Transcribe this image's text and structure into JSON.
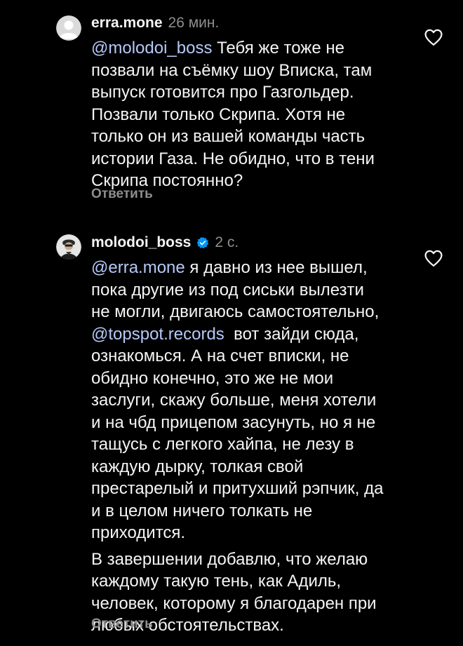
{
  "comments": [
    {
      "username": "erra.mone",
      "time": "26 мин.",
      "verified": false,
      "reply_label": "Ответить",
      "lines": [
        [
          {
            "m": "@molodoi_boss"
          },
          {
            "t": " Тебя же тоже не"
          }
        ],
        [
          {
            "t": "позвали на съёмку шоу Вписка, там"
          }
        ],
        [
          {
            "t": "выпуск готовится про Газгольдер."
          }
        ],
        [
          {
            "t": "Позвали только Скрипа. Хотя не"
          }
        ],
        [
          {
            "t": "только он из вашей команды часть"
          }
        ],
        [
          {
            "t": "истории Газа. Не обидно, что в тени"
          }
        ],
        [
          {
            "t": "Скрипа постоянно?"
          }
        ]
      ]
    },
    {
      "username": "molodoi_boss",
      "time": "2 с.",
      "verified": true,
      "reply_label": "Ответить",
      "lines": [
        [
          {
            "m": "@erra.mone"
          },
          {
            "t": " я давно из нее вышел,"
          }
        ],
        [
          {
            "t": "пока другие из под сиськи вылезти"
          }
        ],
        [
          {
            "t": "не могли, двигаюсь самостоятельно,"
          }
        ],
        [
          {
            "m": "@topspot.records"
          },
          {
            "t": "  вот зайди сюда,"
          }
        ],
        [
          {
            "t": "ознакомься. А на счет вписки, не"
          }
        ],
        [
          {
            "t": "обидно конечно, это же не мои"
          }
        ],
        [
          {
            "t": "заслуги, скажу больше, меня хотели"
          }
        ],
        [
          {
            "t": "и на чбд прицепом засунуть, но я не"
          }
        ],
        [
          {
            "t": "тащусь с легкого хайпа, не лезу в"
          }
        ],
        [
          {
            "t": "каждую дырку, толкая свой"
          }
        ],
        [
          {
            "t": "престарелый и притухший рэпчик, да"
          }
        ],
        [
          {
            "t": "и в целом ничего толкать не"
          }
        ],
        [
          {
            "t": "приходится."
          }
        ]
      ],
      "lines2": [
        [
          {
            "t": "В завершении добавлю, что желаю"
          }
        ],
        [
          {
            "t": "каждому такую тень, как Адиль,"
          }
        ],
        [
          {
            "t": "человек, которому я благодарен при"
          }
        ],
        [
          {
            "t": "любых обстоятельствах."
          }
        ]
      ]
    }
  ],
  "colors": {
    "background": "#000000",
    "text": "#f5f5f5",
    "muted": "#8e8e8e",
    "mention": "#b5c9f8",
    "verified": "#0095f6"
  },
  "icons": {
    "like": "heart-outline-icon",
    "verified": "verified-badge-icon",
    "avatar_default": "default-avatar-icon"
  }
}
